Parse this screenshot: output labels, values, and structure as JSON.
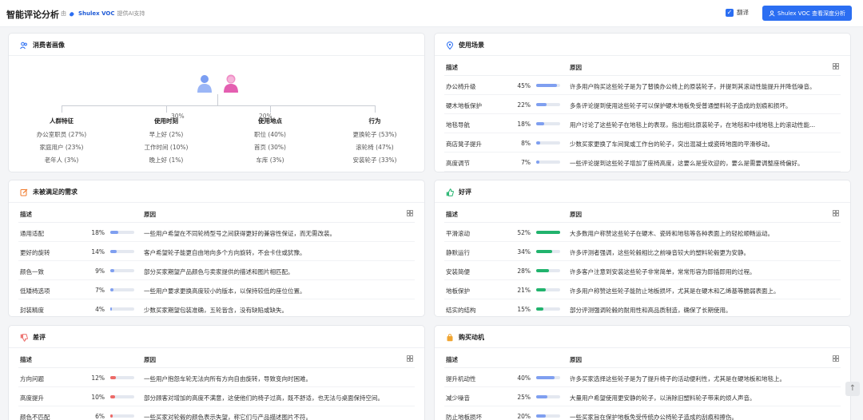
{
  "header": {
    "title": "智能评论分析",
    "by_prefix": "由",
    "brand": "Shulex VOC",
    "by_suffix": "提供AI支持",
    "translate_label": "翻译",
    "cta_label": "Shulex VOC 查看深度分析"
  },
  "persona": {
    "title": "消费者画像",
    "female_pct": "30%",
    "male_pct": "20%",
    "columns": [
      {
        "heading": "人群特征",
        "items": [
          "办公室职员 (27%)",
          "家庭用户 (23%)",
          "老年人 (3%)"
        ]
      },
      {
        "heading": "使用时刻",
        "items": [
          "早上好 (2%)",
          "工作时间 (10%)",
          "晚上好 (1%)"
        ]
      },
      {
        "heading": "使用地点",
        "items": [
          "职位 (40%)",
          "首页 (30%)",
          "车库 (3%)"
        ]
      },
      {
        "heading": "行为",
        "items": [
          "更换轮子 (53%)",
          "滚轮椅 (47%)",
          "安装轮子 (33%)"
        ]
      }
    ]
  },
  "colors": {
    "blue": "#7f9ff0",
    "green": "#21b36d",
    "red": "#ec6a67",
    "track": "#e4e8f0"
  },
  "table_headers": {
    "desc": "描述",
    "reason": "原因"
  },
  "cards": {
    "scenes": {
      "title": "使用场景",
      "rows": [
        {
          "label": "办公椅升级",
          "pct": "45%",
          "value": 45,
          "reason": "许多用户购买这些轮子是为了替换办公椅上的原装轮子，并提到其滚动性能提升并降低噪音。"
        },
        {
          "label": "硬木地板保护",
          "pct": "22%",
          "value": 22,
          "reason": "多条评论提到使用这些轮子可以保护硬木地板免受普通塑料轮子造成的划痕和损坏。"
        },
        {
          "label": "地毯导航",
          "pct": "18%",
          "value": 18,
          "reason": "用户讨论了这些轮子在地毯上的表现，指出相比原装轮子，在地毯和中线地毯上的滚动性能..."
        },
        {
          "label": "商店凳子提升",
          "pct": "8%",
          "value": 8,
          "reason": "少数买家更换了车间凳或工作台的轮子，突出混凝土或瓷砖地面的平滑移动。"
        },
        {
          "label": "高度调节",
          "pct": "7%",
          "value": 7,
          "reason": "一些评论提到这些轮子增加了座椅高度，这要么是受欢迎的，要么是需要调整座椅偏好。"
        }
      ]
    },
    "unmet": {
      "title": "未被满足的需求",
      "rows": [
        {
          "label": "通用适配",
          "pct": "18%",
          "value": 18,
          "reason": "一些用户希望在不同轮椅型号之间获得更好的兼容性保证，而无需改装。"
        },
        {
          "label": "更好的旋转",
          "pct": "14%",
          "value": 14,
          "reason": "客户希望轮子能更自由地向多个方向旋转，不会卡住或犹豫。"
        },
        {
          "label": "颜色一致",
          "pct": "9%",
          "value": 9,
          "reason": "部分买家期望产品颜色与卖家提供的描述和图片相匹配。"
        },
        {
          "label": "低矮椅选项",
          "pct": "7%",
          "value": 7,
          "reason": "一些用户要求更换高度较小的版本，以保持较低的座位位置。"
        },
        {
          "label": "封装精度",
          "pct": "4%",
          "value": 4,
          "reason": "少数买家期望包装准确，五轮皆含，没有缺陷或缺失。"
        }
      ]
    },
    "positive": {
      "title": "好评",
      "rows": [
        {
          "label": "平滑滚动",
          "pct": "52%",
          "value": 52,
          "reason": "大多数用户称赞这些轮子在硬木、瓷砖和地毯等各种表面上的轻松顺畅运动。"
        },
        {
          "label": "静默运行",
          "pct": "34%",
          "value": 34,
          "reason": "许多评测者强调，这些轮毂相比之前噪音较大的塑料轮毂更为安静。"
        },
        {
          "label": "安装简便",
          "pct": "28%",
          "value": 28,
          "reason": "许多客户注意到安装这些轮子非常简单，常常形容为即插即用的过程。"
        },
        {
          "label": "地板保护",
          "pct": "21%",
          "value": 21,
          "reason": "许多用户称赞这些轮子能防止地板损坏，尤其是在硬木和乙烯基等脆弱表面上。"
        },
        {
          "label": "结实的结构",
          "pct": "15%",
          "value": 15,
          "reason": "部分评测强调轮毂的耐用性和高品质制造，确保了长期使用。"
        }
      ]
    },
    "negative": {
      "title": "差评",
      "rows": [
        {
          "label": "方向问题",
          "pct": "12%",
          "value": 12,
          "reason": "一些用户抱怨车轮无法向所有方向自由旋转，导致变向时困难。"
        },
        {
          "label": "高度提升",
          "pct": "10%",
          "value": 10,
          "reason": "部分顾客对增加的高度不满意，这使他们的椅子过高，既不舒适，也无法与桌面保持空间。"
        },
        {
          "label": "颜色不匹配",
          "pct": "6%",
          "value": 6,
          "reason": "一些买家对轮毂的颜色表示失望，称它们与产品描述图片不符。"
        }
      ]
    },
    "motivation": {
      "title": "购买动机",
      "rows": [
        {
          "label": "提升机动性",
          "pct": "40%",
          "value": 40,
          "reason": "许多买家选择这些轮子是为了提升椅子的活动便利性，尤其是在硬地板和地毯上。"
        },
        {
          "label": "减少噪音",
          "pct": "25%",
          "value": 25,
          "reason": "大量用户希望使用更安静的轮子，以消除旧塑料轮子带来的烦人声音。"
        },
        {
          "label": "防止地板损坏",
          "pct": "20%",
          "value": 20,
          "reason": "一些买家旨在保护地板免受传统办公椅轮子造成的刮痕和擦伤。"
        }
      ]
    }
  }
}
